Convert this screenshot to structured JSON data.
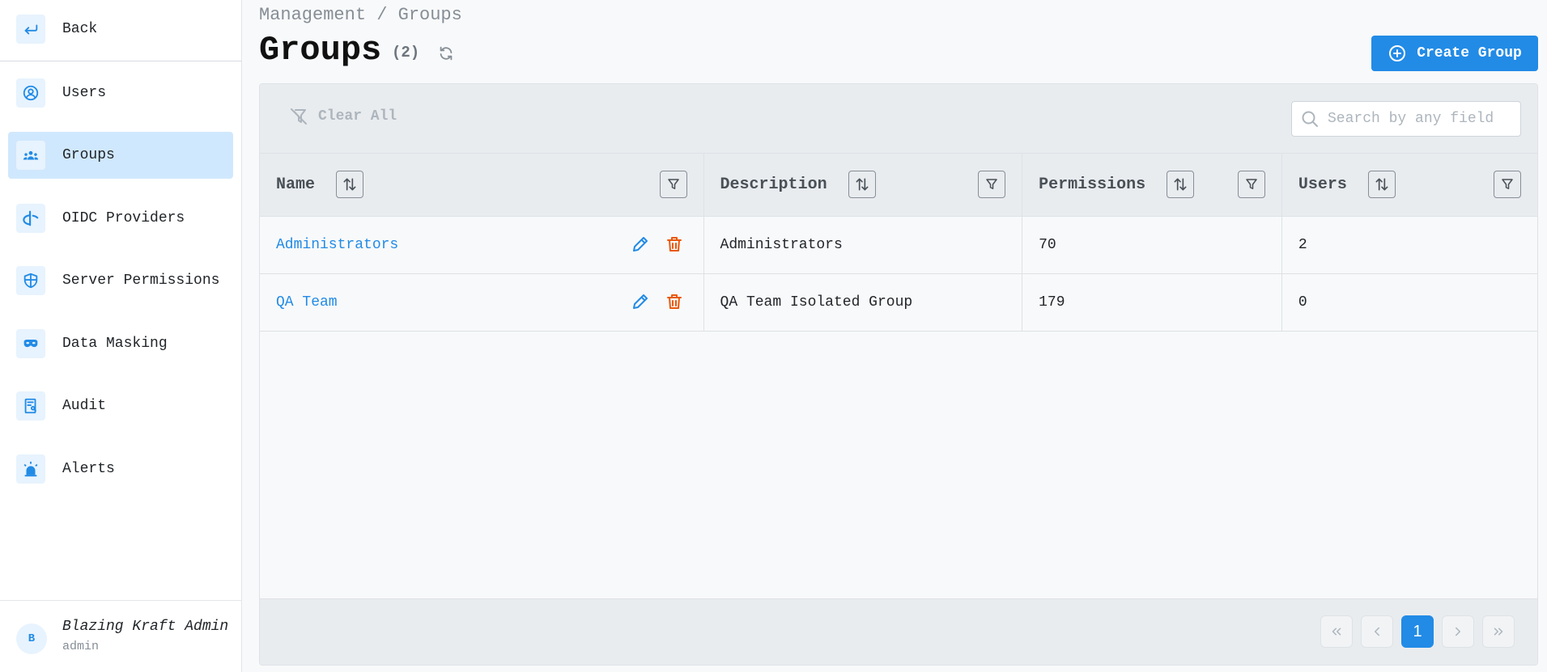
{
  "colors": {
    "accent": "#228be6",
    "danger": "#e8590c",
    "active_nav": "#d0e8fd"
  },
  "sidebar": {
    "back_label": "Back",
    "items": [
      {
        "label": "Users",
        "icon": "user-circle-icon",
        "active": false
      },
      {
        "label": "Groups",
        "icon": "users-group-icon",
        "active": true
      },
      {
        "label": "OIDC Providers",
        "icon": "brand-openid-icon",
        "active": false
      },
      {
        "label": "Server Permissions",
        "icon": "shield-icon",
        "active": false
      },
      {
        "label": "Data Masking",
        "icon": "mask-icon",
        "active": false
      },
      {
        "label": "Audit",
        "icon": "report-icon",
        "active": false
      },
      {
        "label": "Alerts",
        "icon": "alarm-icon",
        "active": false
      }
    ],
    "user": {
      "initial": "B",
      "name": "Blazing Kraft Admin",
      "role": "admin"
    }
  },
  "header": {
    "breadcrumb": "Management / Groups",
    "title": "Groups",
    "count": "(2)",
    "create_label": "Create Group"
  },
  "toolbar": {
    "clear_all_label": "Clear All",
    "search_placeholder": "Search by any field"
  },
  "table": {
    "columns": [
      "Name",
      "Description",
      "Permissions",
      "Users"
    ],
    "rows": [
      {
        "name": "Administrators",
        "description": "Administrators",
        "permissions": "70",
        "users": "2"
      },
      {
        "name": "QA Team",
        "description": "QA Team Isolated Group",
        "permissions": "179",
        "users": "0"
      }
    ]
  },
  "pagination": {
    "current_page": "1"
  }
}
